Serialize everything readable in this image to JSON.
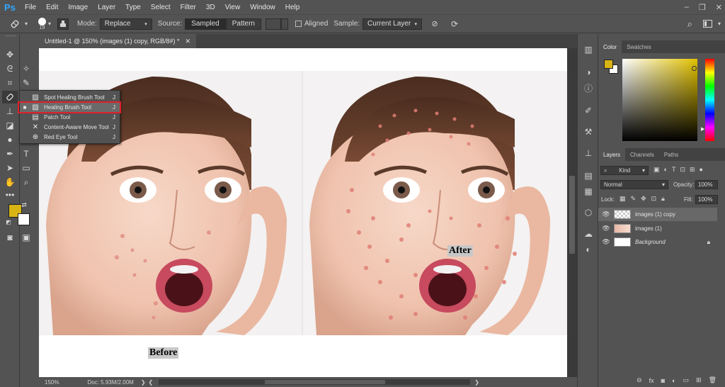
{
  "app": {
    "logo": "Ps"
  },
  "menu": [
    "File",
    "Edit",
    "Image",
    "Layer",
    "Type",
    "Select",
    "Filter",
    "3D",
    "View",
    "Window",
    "Help"
  ],
  "window_controls": {
    "minimize": "–",
    "restore": "❐",
    "close": "✕"
  },
  "options": {
    "brush_size": "19",
    "mode_label": "Mode:",
    "mode_value": "Replace",
    "source_label": "Source:",
    "sampled_label": "Sampled",
    "pattern_label": "Pattern",
    "aligned_label": "Aligned",
    "sample_label": "Sample:",
    "sample_value": "Current Layer"
  },
  "document": {
    "tab_title": "Untitled-1 @ 150% (images (1) copy, RGB/8#) *",
    "zoom": "150%",
    "doc_info": "Doc: 5.93M/2.00M"
  },
  "canvas": {
    "before_label": "Before",
    "after_label": "After"
  },
  "flyout": {
    "items": [
      {
        "label": "Spot Healing Brush Tool",
        "key": "J",
        "selected": ""
      },
      {
        "label": "Healing Brush Tool",
        "key": "J",
        "selected": "■"
      },
      {
        "label": "Patch Tool",
        "key": "J",
        "selected": ""
      },
      {
        "label": "Content-Aware Move Tool",
        "key": "J",
        "selected": ""
      },
      {
        "label": "Red Eye Tool",
        "key": "J",
        "selected": ""
      }
    ]
  },
  "colors": {
    "foreground": "#d8b515",
    "background": "#ffffff",
    "highlight_box": "#e0202a",
    "accent": "#31a8ff"
  },
  "color_panel": {
    "tabs": [
      "Color",
      "Swatches"
    ]
  },
  "layers_panel": {
    "tabs": [
      "Layers",
      "Channels",
      "Paths"
    ],
    "kind_label": "Kind",
    "blend_mode": "Normal",
    "opacity_label": "Opacity:",
    "opacity_value": "100%",
    "lock_label": "Lock:",
    "fill_label": "Fill:",
    "fill_value": "100%",
    "layers": [
      {
        "name": "images (1) copy"
      },
      {
        "name": "images (1)"
      },
      {
        "name": "Background"
      }
    ]
  }
}
